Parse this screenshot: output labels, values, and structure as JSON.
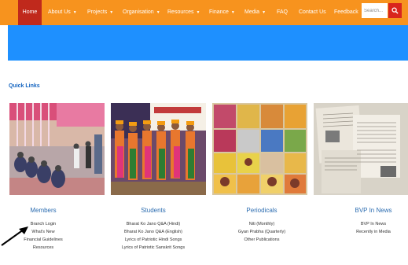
{
  "nav": {
    "home": "Home",
    "items": [
      {
        "label": "About Us",
        "caret": true
      },
      {
        "label": "Projects",
        "caret": true
      },
      {
        "label": "Organisation",
        "caret": true
      },
      {
        "label": "Resources",
        "caret": true
      },
      {
        "label": "Finance",
        "caret": true
      },
      {
        "label": "Media",
        "caret": true
      },
      {
        "label": "FAQ",
        "caret": false
      },
      {
        "label": "Contact Us",
        "caret": false
      },
      {
        "label": "Feedback",
        "caret": false
      }
    ],
    "search_placeholder": "Search...",
    "search_icon": "magnifier-icon"
  },
  "quick_links_title": "Quick Links",
  "columns": [
    {
      "title": "Members",
      "links": [
        "Branch Login",
        "What's New",
        "Financial Guidelines",
        "Resources"
      ]
    },
    {
      "title": "Students",
      "links": [
        "Bharat Ko Jano Q&A (Hindi)",
        "Bharat Ko Jano Q&A (English)",
        "Lyrics of Patriotic Hindi Songs",
        "Lyrics of Patriotic Sanskrit Songs"
      ]
    },
    {
      "title": "Periodicals",
      "links": [
        "Niti (Monthly)",
        "Gyan Prabha (Quarterly)",
        "Other Publications"
      ]
    },
    {
      "title": "BVP In News",
      "links": [
        "BVP In News",
        "Recently in Media"
      ]
    }
  ],
  "colors": {
    "nav_bg": "#f7931e",
    "home_bg": "#c0291c",
    "banner": "#1e90ff",
    "title_blue": "#2b6cb0"
  }
}
